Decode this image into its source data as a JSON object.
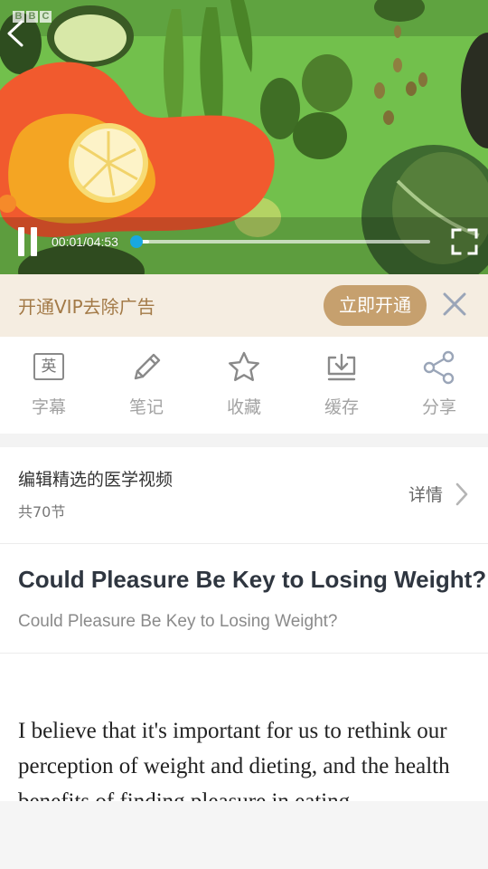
{
  "video": {
    "channel_logo": "BBC",
    "time_display": "00:01/04:53",
    "progress_fraction": 0.0034,
    "icons": {
      "back": "chevron-left-icon",
      "pause": "pause-icon",
      "fullscreen": "fullscreen-icon"
    },
    "colors": {
      "seek_thumb": "#18a8e0",
      "background_green": "#6fbe4a",
      "splash_orange": "#f15a2e"
    }
  },
  "vip_banner": {
    "text": "开通VIP去除广告",
    "button_label": "立即开通",
    "close_icon": "close-icon",
    "colors": {
      "background": "#f5ede1",
      "text": "#a37a47",
      "button": "#c6a06e"
    }
  },
  "toolbar": {
    "items": [
      {
        "label": "字幕",
        "icon": "subtitle-icon",
        "glyph": "英"
      },
      {
        "label": "笔记",
        "icon": "pencil-icon"
      },
      {
        "label": "收藏",
        "icon": "star-icon"
      },
      {
        "label": "缓存",
        "icon": "download-icon"
      },
      {
        "label": "分享",
        "icon": "share-icon"
      }
    ]
  },
  "course": {
    "title": "编辑精选的医学视频",
    "count": "共70节",
    "details_label": "详情"
  },
  "lesson": {
    "title": "Could Pleasure Be Key to Losing Weight?",
    "subtitle": "Could Pleasure Be Key to Losing Weight?",
    "body": "I believe that it's important for us to rethink our perception of weight and dieting, and the health benefits of finding pleasure in eating."
  }
}
